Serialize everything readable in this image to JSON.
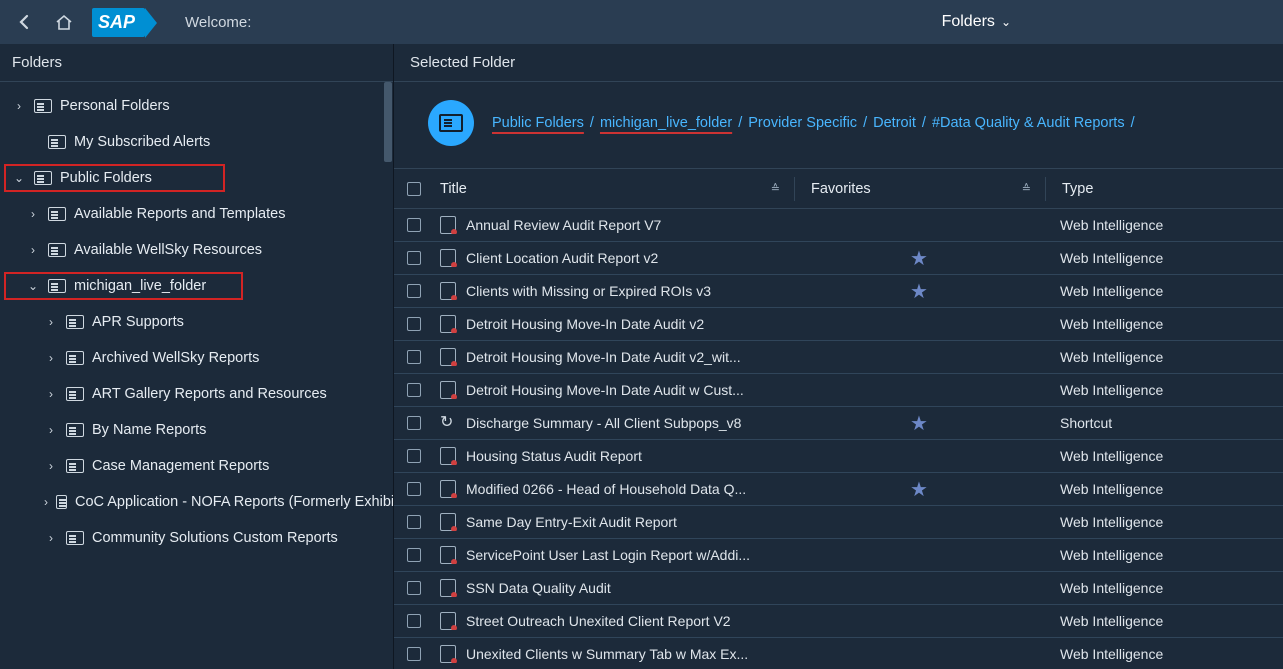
{
  "topbar": {
    "welcome": "Welcome:",
    "folders_label": "Folders"
  },
  "sidebar": {
    "header": "Folders",
    "personal": "Personal Folders",
    "alerts": "My Subscribed Alerts",
    "public": "Public Folders",
    "avail_reports": "Available Reports and Templates",
    "avail_wellsky": "Available WellSky Resources",
    "michigan": "michigan_live_folder",
    "sub": {
      "apr": "APR Supports",
      "archived": "Archived WellSky Reports",
      "art": "ART Gallery Reports and Resources",
      "byname": "By Name Reports",
      "casemgmt": "Case Management Reports",
      "coc": "CoC Application - NOFA Reports (Formerly Exhibit",
      "community": "Community Solutions Custom Reports"
    }
  },
  "content": {
    "header": "Selected Folder",
    "crumbs": {
      "public": "Public Folders",
      "michigan": "michigan_live_folder",
      "provider": "Provider Specific",
      "detroit": "Detroit",
      "dq": "#Data Quality & Audit Reports"
    },
    "columns": {
      "title": "Title",
      "fav": "Favorites",
      "type": "Type"
    }
  },
  "rows": [
    {
      "title": "Annual Review Audit Report V7",
      "fav": false,
      "type": "Web Intelligence",
      "icon": "doc"
    },
    {
      "title": "Client Location Audit Report v2",
      "fav": true,
      "type": "Web Intelligence",
      "icon": "doc"
    },
    {
      "title": "Clients with Missing or Expired ROIs v3",
      "fav": true,
      "type": "Web Intelligence",
      "icon": "doc"
    },
    {
      "title": "Detroit Housing Move-In Date Audit v2",
      "fav": false,
      "type": "Web Intelligence",
      "icon": "doc"
    },
    {
      "title": "Detroit Housing Move-In Date Audit v2_wit...",
      "fav": false,
      "type": "Web Intelligence",
      "icon": "doc"
    },
    {
      "title": "Detroit Housing Move-In Date Audit w Cust...",
      "fav": false,
      "type": "Web Intelligence",
      "icon": "doc"
    },
    {
      "title": "Discharge Summary - All Client Subpops_v8",
      "fav": true,
      "type": "Shortcut",
      "icon": "shortcut"
    },
    {
      "title": "Housing Status Audit Report",
      "fav": false,
      "type": "Web Intelligence",
      "icon": "doc"
    },
    {
      "title": "Modified 0266 - Head of Household Data Q...",
      "fav": true,
      "type": "Web Intelligence",
      "icon": "doc"
    },
    {
      "title": "Same Day Entry-Exit Audit Report",
      "fav": false,
      "type": "Web Intelligence",
      "icon": "doc"
    },
    {
      "title": "ServicePoint User Last Login Report w/Addi...",
      "fav": false,
      "type": "Web Intelligence",
      "icon": "doc"
    },
    {
      "title": "SSN Data Quality Audit",
      "fav": false,
      "type": "Web Intelligence",
      "icon": "doc"
    },
    {
      "title": "Street Outreach Unexited Client Report V2",
      "fav": false,
      "type": "Web Intelligence",
      "icon": "doc"
    },
    {
      "title": "Unexited Clients w Summary Tab w Max Ex...",
      "fav": false,
      "type": "Web Intelligence",
      "icon": "doc"
    }
  ]
}
